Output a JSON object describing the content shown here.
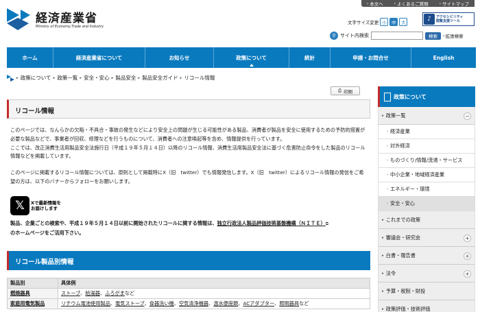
{
  "header": {
    "logo_ja": "経済産業省",
    "logo_en": "Ministry of Economy,Trade and Industry",
    "toplinks": [
      "本文へ",
      "よくあるご質問",
      "サイトマップ"
    ],
    "font_size_label": "文字サイズ変更",
    "font_sizes": [
      "小",
      "中",
      "大"
    ],
    "accessibility_line1": "アクセシビリティ",
    "accessibility_line2": "閲覧支援ツール",
    "search_label": "サイト内検索",
    "search_placeholder": "",
    "search_button": "検索",
    "advanced_search": "拡張検索"
  },
  "nav": [
    "ホーム",
    "経済産業省について",
    "お知らせ",
    "政策について",
    "統計",
    "申請・お問合せ",
    "English"
  ],
  "breadcrumb": [
    "政策について",
    "政策一覧",
    "安全・安心",
    "製品安全",
    "製品安全ガイド",
    "リコール情報"
  ],
  "print_label": "印刷",
  "page_title": "リコール情報",
  "intro": [
    "このページでは、なんらかの欠陥・不具合・事故の発生などにより安全上の問題が生じる可能性がある製品、消費者が製品を安全に使用するための予防的措置が必要な製品などで、事業者が回収、修理などを行うものについて、消費者への注意喚起等を含め、情報提供を行っています。",
    "ここでは、改正消費生活用製品安全法施行日（平成１９年５月１４日）以降のリコール情報、消費生活用製品安全法に基づく危害防止命令をした製品のリコール情報などを掲載しています。"
  ],
  "x_info": "このページに掲載するリコール情報については、原則として掲載時にX（旧　twitter）でも情報発信します。X（旧　twitter）によるリコール情報の発信をご希望の方は、以下のバナーからフォローをお願いします。",
  "x_banner_line1": "Xで最新情報を",
  "x_banner_line2": "お届けします",
  "nite_pre": "製品、企業ごとの検索や、平成１９年５月１４日以前に開始されたリコールに関する情報は、",
  "nite_link": "独立行政法人製品評価技術基盤機構（ＮＩＴＥ）",
  "nite_post": "のホームページをご活用下さい。",
  "section_title": "リコール製品別情報",
  "table": {
    "headers": [
      "製品別",
      "具体例"
    ],
    "rows": [
      {
        "category": "燃焼器具",
        "examples": [
          "ストーブ",
          "給湯器",
          "ふろがま"
        ],
        "suffix": "など"
      },
      {
        "category": "家庭用電気製品",
        "examples": [
          "リチウム電池使用製品",
          "電気ストーブ",
          "食器洗い機",
          "空気清浄機器",
          "温水便座類",
          "ACアダプター",
          "照明器具"
        ],
        "suffix": "など"
      }
    ]
  },
  "sidebar": {
    "title": "政策について",
    "items": [
      {
        "label": "政策一覧",
        "toggle": "−",
        "open": true
      },
      {
        "label": "これまでの政策",
        "toggle": "",
        "open": false
      },
      {
        "label": "審議会・研究会",
        "toggle": "+",
        "open": false
      },
      {
        "label": "白書・報告書",
        "toggle": "+",
        "open": false
      },
      {
        "label": "法令",
        "toggle": "+",
        "open": false
      },
      {
        "label": "予算・税制・財投",
        "toggle": "",
        "open": false
      },
      {
        "label": "政策評価・技術評価",
        "toggle": "",
        "open": false
      }
    ],
    "sub_items": [
      "経済産業",
      "対外経済",
      "ものづくり/情報/流通・サービス",
      "中小企業・地域経済産業",
      "エネルギー・環境",
      "安全・安心"
    ],
    "active_sub": "安全・安心"
  },
  "colors": {
    "brand_blue": "#0a7abf",
    "accent_red": "#c42b2b"
  }
}
